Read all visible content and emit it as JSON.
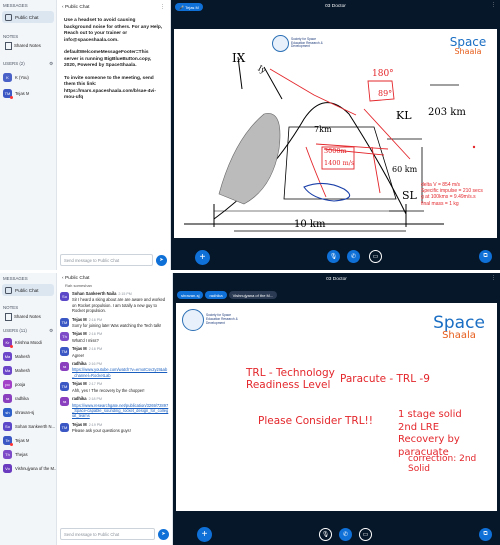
{
  "shot1": {
    "left": {
      "messages_header": "MESSAGES",
      "public_chat": "Public Chat",
      "notes_header": "NOTES",
      "shared_notes": "Shared Notes",
      "users_header": "USERS (2)",
      "users": [
        {
          "initials": "K",
          "name": "K (You)",
          "color": "#4a62c8",
          "mod": false
        },
        {
          "initials": "TM",
          "name": "Tejas M",
          "color": "#3b57c4",
          "mod": true
        }
      ]
    },
    "chat": {
      "title": "Public Chat",
      "welcome_1": "Use a headset to avoid causing background noise for others. For any Help, Reach out to your trainer or info@spaceshaala.com.",
      "welcome_2": "defaultWelcomeMessageFooter=This server is running BigBlueButton.copy, 2020, Powered by SpaceShaala.",
      "welcome_3": "To invite someone to the meeting, send them this link: https://mars.spaceshaala.com/b/sae-4vi-mou-ufq",
      "input_placeholder": "Send message to Public Chat"
    },
    "presentation": {
      "title": "03 Doctor",
      "presenter_pill": "Tejas M",
      "slide_handwritten": {
        "ix": "IX",
        "iy": "Iy",
        "t180": "180°",
        "t89": "89°",
        "kl": "KL",
        "km203": "203 km",
        "km7": "7km",
        "t3000": "3000m",
        "t1400": "1400 m/s",
        "km60": "60 km",
        "sl": "SL",
        "km10": "10 km"
      },
      "slide_info": [
        "delta V = 854 m/s",
        "Specific impulse = 210 secs",
        "g at 100kms = 9.49m/s.s",
        "final mass = 1 kg"
      ],
      "brand_space": "Space",
      "brand_shaala": "Shaala",
      "society_text": "Society for Space Education Research & Development",
      "society_tagline": "EDUCATE · INSPIRE · INNOVATE"
    }
  },
  "shot2": {
    "left": {
      "messages_header": "MESSAGES",
      "public_chat": "Public Chat",
      "notes_header": "NOTES",
      "shared_notes": "Shared Notes",
      "users_header": "USERS (11)",
      "users": [
        {
          "initials": "Kr",
          "name": "Krishna Moodi",
          "color": "#7b3fbf",
          "mod": true
        },
        {
          "initials": "Ma",
          "name": "Mahesh",
          "color": "#6b46c8",
          "mod": false
        },
        {
          "initials": "Ma",
          "name": "Mahesh",
          "color": "#6b46c8",
          "mod": false
        },
        {
          "initials": "po",
          "name": "pooja",
          "color": "#a240c8",
          "mod": false
        },
        {
          "initials": "ra",
          "name": "radhika",
          "color": "#8a3fbf",
          "mod": false
        },
        {
          "initials": "sh",
          "name": "shravan-sj",
          "color": "#2f5fc8",
          "mod": false
        },
        {
          "initials": "So",
          "name": "Sohan Sankeerth N...",
          "color": "#5a48c8",
          "mod": false
        },
        {
          "initials": "Te",
          "name": "Tejas M",
          "color": "#3b57c4",
          "mod": true
        },
        {
          "initials": "Th",
          "name": "Thejas",
          "color": "#7d4ac8",
          "mod": false
        },
        {
          "initials": "Vo",
          "name": "Vishnujyana of the M...",
          "color": "#6a3bbf",
          "mod": false
        }
      ]
    },
    "chat": {
      "title": "Public Chat",
      "top_snippet": "Rah someshan",
      "messages": [
        {
          "initials": "So",
          "color": "#5a48c8",
          "name": "Sohan Sankeerth Naila",
          "time": "2:15 PM",
          "text": "Sir I heard a sking about are are aware and worked on Rocket propulsion. I am totally a new guy to Rocket propulsion.",
          "link": ""
        },
        {
          "initials": "TM",
          "color": "#3b57c4",
          "name": "Tejas M",
          "time": "2:16 PM",
          "text": "Sorry for joining late! Was watching the Tech talk!",
          "link": ""
        },
        {
          "initials": "Th",
          "color": "#7d4ac8",
          "name": "Tejas M",
          "time": "2:16 PM",
          "text": "What'd I miss?",
          "link": ""
        },
        {
          "initials": "TM",
          "color": "#3b57c4",
          "name": "Tejas M",
          "time": "2:16 PM",
          "text": "Agree!",
          "link": ""
        },
        {
          "initials": "ra",
          "color": "#8a3fbf",
          "name": "radhika",
          "time": "2:16 PM",
          "text": "",
          "link": "https://www.youtube.com/watch?v=emoICsv2y2I&ab_channel=RocketLab"
        },
        {
          "initials": "TM",
          "color": "#3b57c4",
          "name": "Tejas M",
          "time": "2:17 PM",
          "text": "Ahh, yes ! The recovery by the chopper!",
          "link": ""
        },
        {
          "initials": "ra",
          "color": "#8a3fbf",
          "name": "radhika",
          "time": "2:18 PM",
          "text": "",
          "link": "https://www.researchgate.net/publication/3269/72897_Space-capable_sounding_rocket_design_for_collegiat_teams"
        },
        {
          "initials": "TM",
          "color": "#3b57c4",
          "name": "Tejas M",
          "time": "2:19 PM",
          "text": "Please ask your questions guys!",
          "link": ""
        }
      ],
      "input_placeholder": "Send message to Public Chat"
    },
    "presentation": {
      "title": "03 Doctor",
      "pills": [
        "shravan-sj",
        "radhika",
        "Vishnujyana of the M..."
      ],
      "slide": {
        "trl_title_1": "TRL - Technology",
        "trl_title_2": "Readiness Level",
        "paracute": "Paracute - TRL -9",
        "consider": "Please Consider TRL!!",
        "stage_1": "1 stage solid",
        "stage_2": "2nd LRE",
        "stage_3": "Recovery by paracuate",
        "correction": "correction: 2nd Solid"
      },
      "brand_space": "Space",
      "brand_shaala": "Shaala",
      "society_text": "Society for Space Education Research & Development",
      "society_tagline": "EDUCATE · INSPIRE · INNOVATE"
    }
  },
  "colors": {
    "accent": "#0f70d7",
    "presentation_bg": "#06172a",
    "handwriting_red": "#e3262b",
    "slide_red": "#e3262b",
    "link": "#1a5fbf"
  }
}
